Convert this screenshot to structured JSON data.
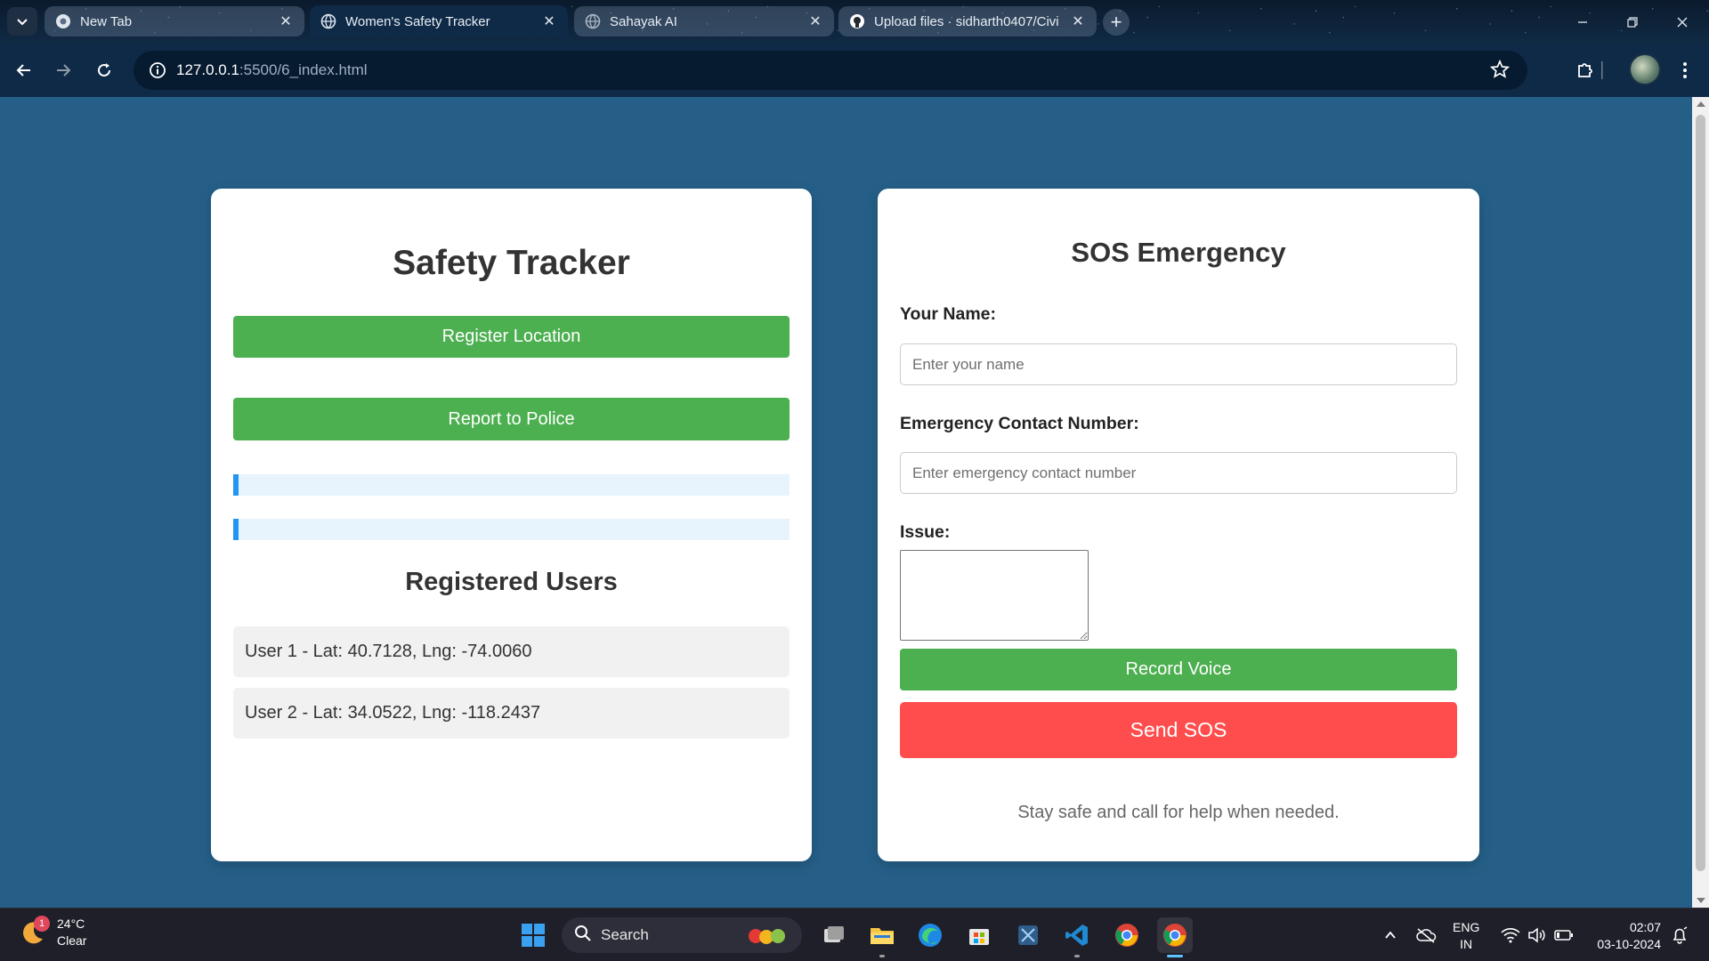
{
  "browser": {
    "tabs": [
      {
        "title": "New Tab",
        "icon": "chrome-icon"
      },
      {
        "title": "Women's Safety Tracker",
        "icon": "globe-icon",
        "active": true
      },
      {
        "title": "Sahayak AI",
        "icon": "globe-icon"
      },
      {
        "title": "Upload files · sidharth0407/Civi",
        "icon": "github-icon"
      }
    ],
    "url_host": "127.0.0.1",
    "url_path": ":5500/6_index.html"
  },
  "tracker": {
    "title": "Safety Tracker",
    "register_button": "Register Location",
    "report_button": "Report to Police",
    "progress_fill": [
      0.01,
      0.01
    ],
    "users_heading": "Registered Users",
    "users": [
      "User 1 - Lat: 40.7128, Lng: -74.0060",
      "User 2 - Lat: 34.0522, Lng: -118.2437"
    ]
  },
  "sos": {
    "title": "SOS Emergency",
    "name_label": "Your Name:",
    "name_placeholder": "Enter your name",
    "contact_label": "Emergency Contact Number:",
    "contact_placeholder": "Enter emergency contact number",
    "issue_label": "Issue:",
    "record_button": "Record Voice",
    "send_button": "Send SOS",
    "footnote": "Stay safe and call for help when needed."
  },
  "taskbar": {
    "weather_temp": "24°C",
    "weather_desc": "Clear",
    "weather_badge": "1",
    "search_label": "Search",
    "lang_top": "ENG",
    "lang_bottom": "IN",
    "time": "02:07",
    "date": "03-10-2024"
  },
  "colors": {
    "page_bg": "#255f88",
    "green": "#4caf50",
    "red": "#ff4d4d",
    "progress": "#2196f3"
  }
}
